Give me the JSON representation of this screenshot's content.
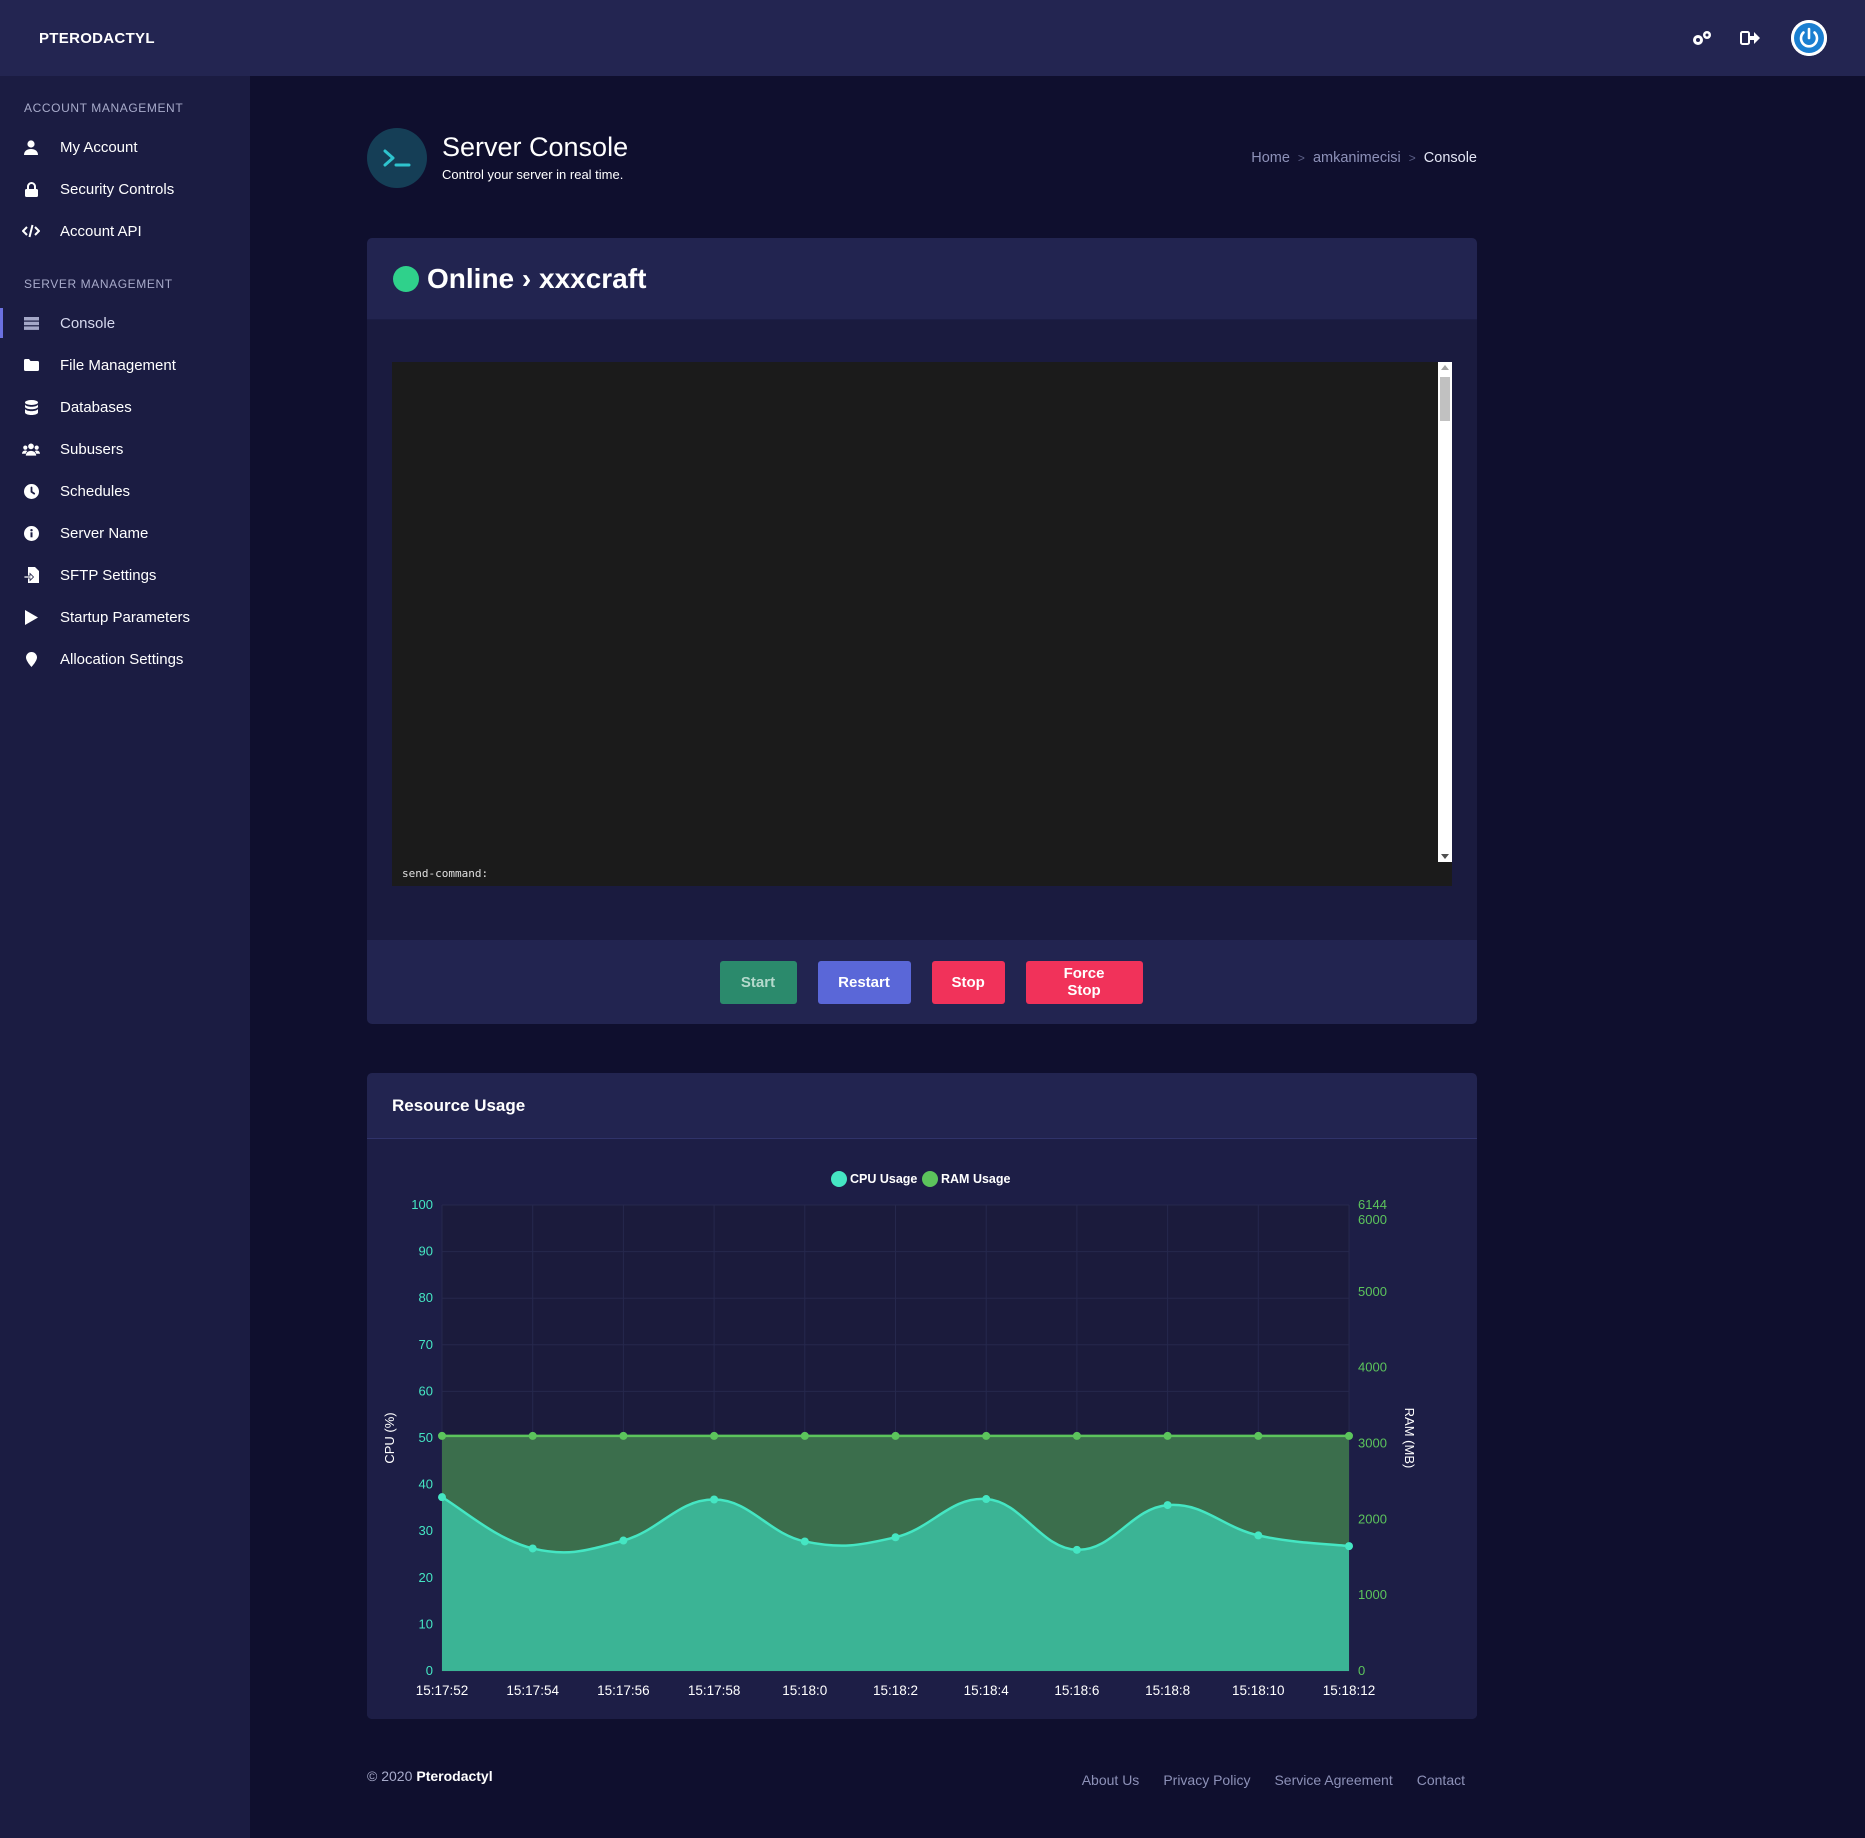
{
  "topbar": {
    "brand": "PTERODACTYL",
    "icons": [
      "admin-gear-icon",
      "logout-icon",
      "power-icon"
    ]
  },
  "sidebar": {
    "sections": [
      {
        "title": "ACCOUNT MANAGEMENT",
        "items": [
          {
            "label": "My Account",
            "icon": "user-icon"
          },
          {
            "label": "Security Controls",
            "icon": "lock-icon"
          },
          {
            "label": "Account API",
            "icon": "code-icon"
          }
        ]
      },
      {
        "title": "SERVER MANAGEMENT",
        "items": [
          {
            "label": "Console",
            "icon": "terminal-icon",
            "active": true
          },
          {
            "label": "File Management",
            "icon": "folder-icon"
          },
          {
            "label": "Databases",
            "icon": "database-icon"
          },
          {
            "label": "Subusers",
            "icon": "users-icon"
          },
          {
            "label": "Schedules",
            "icon": "clock-icon"
          },
          {
            "label": "Server Name",
            "icon": "info-icon"
          },
          {
            "label": "SFTP Settings",
            "icon": "file-transfer-icon"
          },
          {
            "label": "Startup Parameters",
            "icon": "play-icon"
          },
          {
            "label": "Allocation Settings",
            "icon": "map-pin-icon"
          }
        ]
      }
    ]
  },
  "page": {
    "title": "Server Console",
    "subtitle": "Control your server in real time.",
    "breadcrumb": [
      "Home",
      "amkanimecisi",
      "Console"
    ]
  },
  "console": {
    "status": "Online",
    "server_name": "xxxcraft",
    "status_title": "Online › xxxcraft",
    "command_prompt": "send-command:",
    "command_value": "",
    "buttons": {
      "start": "Start",
      "restart": "Restart",
      "stop": "Stop",
      "force_stop": "Force Stop"
    }
  },
  "resource": {
    "title": "Resource Usage"
  },
  "colors": {
    "cpu": "#45e6c3",
    "ram": "#5cc45c",
    "online": "#2fd18b",
    "danger": "#f1325a",
    "primary": "#5a67d8"
  },
  "chart_data": {
    "type": "area",
    "x": [
      "15:17:52",
      "15:17:54",
      "15:17:56",
      "15:17:58",
      "15:18:0",
      "15:18:2",
      "15:18:4",
      "15:18:6",
      "15:18:8",
      "15:18:10",
      "15:18:12"
    ],
    "series": [
      {
        "name": "CPU Usage",
        "axis": "left",
        "values": [
          37.3,
          26.3,
          28.0,
          36.8,
          27.8,
          28.7,
          36.9,
          26.0,
          35.6,
          29.1,
          26.8
        ]
      },
      {
        "name": "RAM Usage",
        "axis": "right",
        "values": [
          3100,
          3100,
          3100,
          3100,
          3100,
          3100,
          3100,
          3100,
          3100,
          3100,
          3100
        ]
      }
    ],
    "ylabel": "CPU (%)",
    "ylabel_right": "RAM (MB)",
    "ylim": [
      0,
      100
    ],
    "ylim_right": [
      0,
      6144
    ],
    "yticks": [
      0,
      10,
      20,
      30,
      40,
      50,
      60,
      70,
      80,
      90,
      100
    ],
    "yticks_right": [
      0,
      1000,
      2000,
      3000,
      4000,
      5000,
      6000,
      6144
    ],
    "legend": "top-center",
    "grid": true
  },
  "footer": {
    "copyright": "© 2020",
    "brand": "Pterodactyl",
    "links": [
      "About Us",
      "Privacy Policy",
      "Service Agreement",
      "Contact"
    ]
  }
}
